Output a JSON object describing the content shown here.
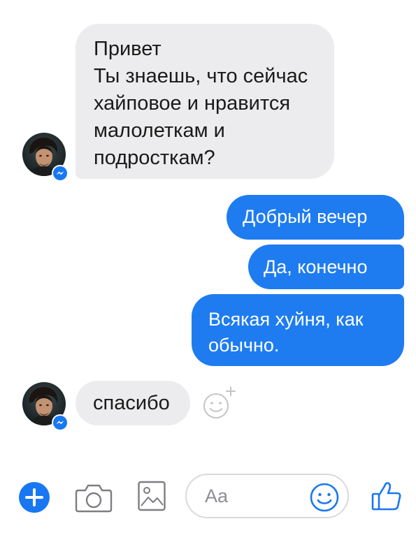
{
  "conversation": {
    "messages": [
      {
        "direction": "incoming",
        "text": "Привет\nТы знаешь, что сейчас хайповое и нравится малолеткам и подросткам?"
      },
      {
        "direction": "outgoing",
        "text": "Добрый вечер"
      },
      {
        "direction": "outgoing",
        "text": "Да, конечно"
      },
      {
        "direction": "outgoing",
        "text": "Всякая хуйня, как обычно."
      },
      {
        "direction": "incoming",
        "text": "спасибо"
      }
    ]
  },
  "composer": {
    "placeholder": "Aa"
  },
  "icons": {
    "add": "plus-icon",
    "camera": "camera-icon",
    "gallery": "gallery-icon",
    "emoji": "smiley-icon",
    "like": "thumbs-up-icon",
    "react": "add-reaction-icon",
    "badge": "messenger-badge-icon"
  },
  "colors": {
    "outgoing_bubble": "#1e7cf0",
    "incoming_bubble": "#ececee",
    "accent": "#1877f2"
  }
}
